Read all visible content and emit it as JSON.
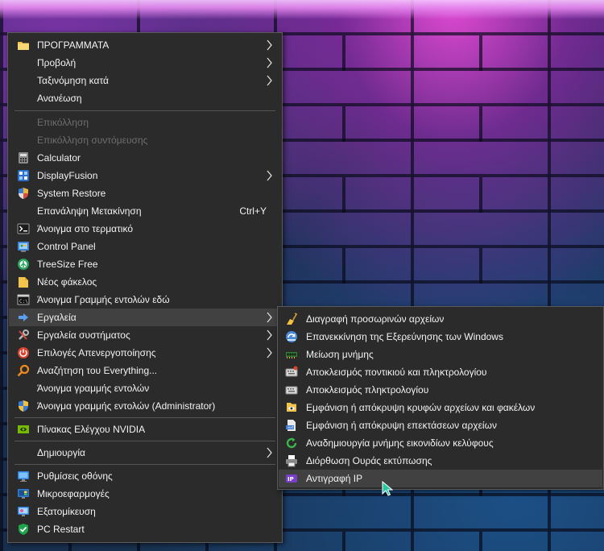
{
  "main_menu": {
    "items": [
      {
        "label": "ΠΡΟΓΡΑΜΜΑΤΑ",
        "icon": "folder-icon",
        "submenu": true
      },
      {
        "label": "Προβολή",
        "submenu": true
      },
      {
        "label": "Ταξινόμηση κατά",
        "submenu": true
      },
      {
        "label": "Ανανέωση"
      },
      {
        "label": "Επικόλληση",
        "disabled": true
      },
      {
        "label": "Επικόλληση συντόμευσης",
        "disabled": true
      },
      {
        "label": "Calculator",
        "icon": "calculator-icon"
      },
      {
        "label": "DisplayFusion",
        "icon": "displayfusion-icon",
        "submenu": true
      },
      {
        "label": "System Restore",
        "icon": "shield-icon"
      },
      {
        "label": "Επανάληψη Μετακίνηση",
        "shortcut": "Ctrl+Y"
      },
      {
        "label": "Άνοιγμα στο τερματικό",
        "icon": "terminal-icon"
      },
      {
        "label": "Control Panel",
        "icon": "control-panel-icon"
      },
      {
        "label": "TreeSize Free",
        "icon": "treesize-icon"
      },
      {
        "label": "Νέος φάκελος",
        "icon": "new-folder-icon"
      },
      {
        "label": "Άνοιγμα Γραμμής εντολών εδώ",
        "icon": "cmd-icon"
      },
      {
        "label": "Εργαλεία",
        "icon": "arrow-right-icon",
        "submenu": true
      },
      {
        "label": "Εργαλεία συστήματος",
        "icon": "tools-icon",
        "submenu": true
      },
      {
        "label": "Επιλογές Απενεργοποίησης",
        "icon": "power-icon",
        "submenu": true
      },
      {
        "label": "Αναζήτηση του Everything...",
        "icon": "search-icon"
      },
      {
        "label": "Άνοιγμα γραμμής εντολών"
      },
      {
        "label": "Άνοιγμα γραμμής εντολών (Administrator)",
        "icon": "admin-shield-icon"
      },
      {
        "label": "Πίνακας Ελέγχου NVIDIA",
        "icon": "nvidia-icon"
      },
      {
        "label": "Δημιουργία",
        "submenu": true
      },
      {
        "label": "Ρυθμίσεις οθόνης",
        "icon": "display-settings-icon"
      },
      {
        "label": "Μικροεφαρμογές",
        "icon": "gadgets-icon"
      },
      {
        "label": "Εξατομίκευση",
        "icon": "personalize-icon"
      },
      {
        "label": "PC Restart",
        "icon": "check-shield-icon"
      }
    ]
  },
  "sub_menu": {
    "items": [
      {
        "label": "Διαγραφή προσωρινών αρχείων",
        "icon": "broom-icon"
      },
      {
        "label": "Επανεκκίνηση της Εξερεύνησης των Windows",
        "icon": "explorer-restart-icon"
      },
      {
        "label": "Μείωση μνήμης",
        "icon": "memory-icon"
      },
      {
        "label": "Αποκλεισμός ποντικιού και πληκτρολογίου",
        "icon": "keyboard-mouse-lock-icon"
      },
      {
        "label": "Αποκλεισμός πληκτρολογίου",
        "icon": "keyboard-lock-icon"
      },
      {
        "label": "Εμφάνιση ή απόκρυψη κρυφών αρχείων και φακέλων",
        "icon": "hidden-files-icon"
      },
      {
        "label": "Εμφάνιση ή απόκρυψη επεκτάσεων αρχείων",
        "icon": "file-extensions-icon"
      },
      {
        "label": "Αναδημιουργία μνήμης εικονιδίων κελύφους",
        "icon": "refresh-icon"
      },
      {
        "label": "Διόρθωση Ουράς εκτύπωσης",
        "icon": "printer-icon"
      },
      {
        "label": "Αντιγραφή IP",
        "icon": "copy-ip-icon"
      }
    ]
  },
  "colors": {
    "menu_bg": "#2b2b2b",
    "highlight": "#414141",
    "disabled_text": "#6e6e6e",
    "text": "#f2f2f2"
  }
}
